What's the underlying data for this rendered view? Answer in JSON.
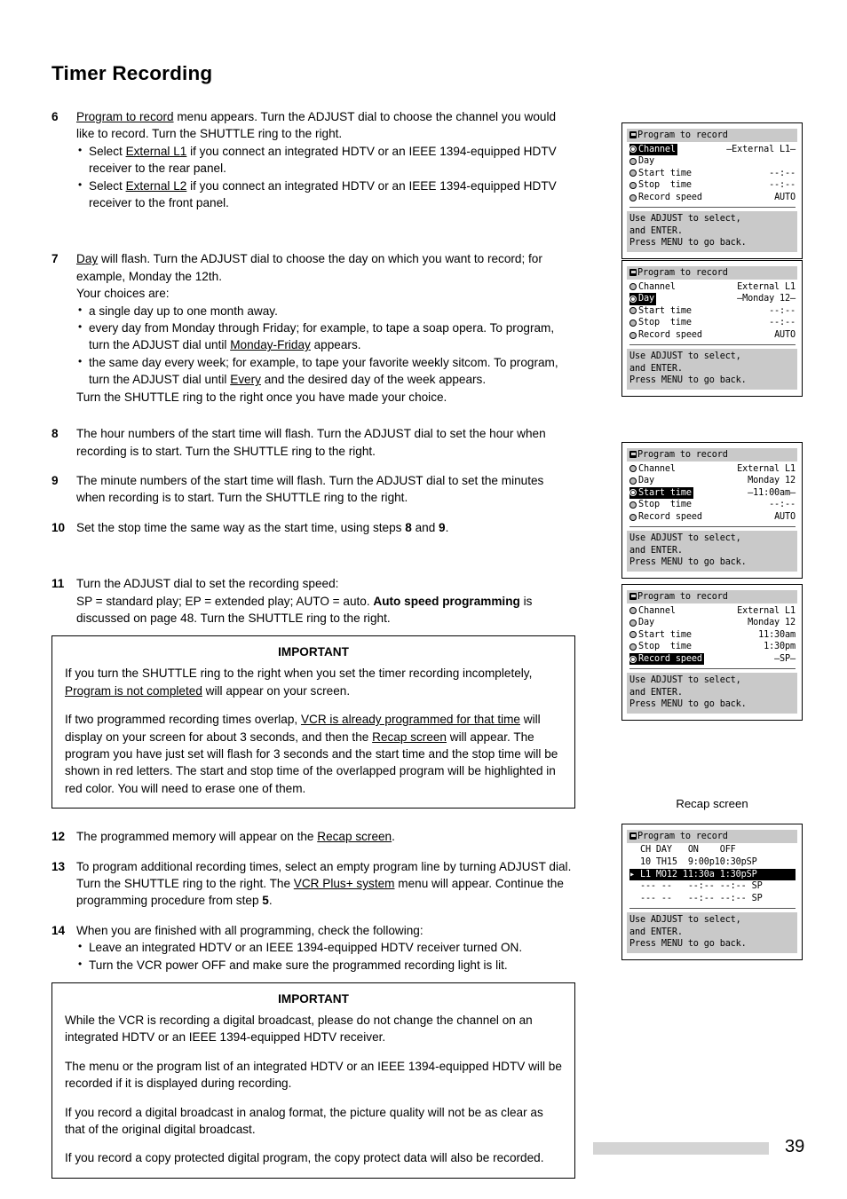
{
  "page": {
    "title": "Timer Recording",
    "number": "39"
  },
  "steps": [
    {
      "num": "6",
      "lines": [
        [
          {
            "t": "Program to record",
            "u": true
          },
          {
            "t": " menu appears.  Turn the ADJUST dial to choose the channel you would like to record.  Turn the SHUTTLE ring to the right."
          }
        ]
      ],
      "bullets": [
        [
          {
            "t": "Select "
          },
          {
            "t": "External L1",
            "u": true
          },
          {
            "t": " if you connect an integrated HDTV or an IEEE 1394-equipped HDTV receiver to the rear panel."
          }
        ],
        [
          {
            "t": "Select "
          },
          {
            "t": "External L2",
            "u": true
          },
          {
            "t": " if you connect an integrated HDTV or an IEEE 1394-equipped HDTV receiver to the front panel."
          }
        ]
      ]
    },
    {
      "num": "7",
      "lines": [
        [
          {
            "t": "Day",
            "u": true
          },
          {
            "t": " will flash.  Turn the ADJUST dial to choose the day on which you want to record; for example, Monday the 12th."
          }
        ],
        [
          {
            "t": "Your choices are:"
          }
        ]
      ],
      "bullets": [
        [
          {
            "t": "a single day up to one month away."
          }
        ],
        [
          {
            "t": "every day from Monday through Friday; for example, to tape a soap opera. To program, turn the ADJUST dial until "
          },
          {
            "t": "Monday-Friday",
            "u": true
          },
          {
            "t": " appears."
          }
        ],
        [
          {
            "t": "the same day every week; for example, to tape your favorite weekly sitcom. To program, turn the ADJUST dial until "
          },
          {
            "t": "Every",
            "u": true
          },
          {
            "t": " and the desired day of the week appears."
          }
        ]
      ],
      "after": [
        [
          {
            "t": "Turn the SHUTTLE ring to the right once you have made your choice."
          }
        ]
      ]
    },
    {
      "num": "8",
      "lines": [
        [
          {
            "t": "The hour numbers of the start time will flash.  Turn the ADJUST dial to set the hour when recording is to start.  Turn the SHUTTLE ring to the right."
          }
        ]
      ]
    },
    {
      "num": "9",
      "lines": [
        [
          {
            "t": "The minute numbers of the start time will flash.  Turn the ADJUST dial to set the minutes when recording is to start.  Turn the SHUTTLE ring to the right."
          }
        ]
      ]
    },
    {
      "num": "10",
      "lines": [
        [
          {
            "t": "Set the stop time the same way as the start time, using steps "
          },
          {
            "t": "8",
            "b": true
          },
          {
            "t": " and "
          },
          {
            "t": "9",
            "b": true
          },
          {
            "t": "."
          }
        ]
      ]
    },
    {
      "num": "11",
      "lines": [
        [
          {
            "t": "Turn the ADJUST dial to set the recording speed:"
          }
        ],
        [
          {
            "t": "SP = standard play; EP = extended play; AUTO = auto.  "
          },
          {
            "t": "Auto speed programming",
            "b": true
          },
          {
            "t": " is discussed on page 48.  Turn the SHUTTLE ring to the right."
          }
        ]
      ]
    },
    {
      "num": "12",
      "lines": [
        [
          {
            "t": "The programmed memory will appear on the "
          },
          {
            "t": "Recap screen",
            "u": true
          },
          {
            "t": "."
          }
        ]
      ]
    },
    {
      "num": "13",
      "lines": [
        [
          {
            "t": "To program additional recording times, select an empty program line by turning ADJUST dial.  Turn the SHUTTLE ring to the right.  The "
          },
          {
            "t": "VCR Plus+ system",
            "u": true
          },
          {
            "t": " menu will appear.  Continue the programming procedure from step "
          },
          {
            "t": "5",
            "b": true
          },
          {
            "t": "."
          }
        ]
      ]
    },
    {
      "num": "14",
      "lines": [
        [
          {
            "t": "When you are finished with all programming, check the following:"
          }
        ]
      ],
      "bullets": [
        [
          {
            "t": "Leave an integrated HDTV or an IEEE 1394-equipped HDTV receiver turned ON."
          }
        ],
        [
          {
            "t": "Turn the VCR power OFF and make sure the programmed recording light is lit."
          }
        ]
      ]
    }
  ],
  "important_box_1": {
    "title": "IMPORTANT",
    "paragraphs": [
      [
        {
          "t": "If you turn the SHUTTLE ring to the right when you set the timer recording incompletely, "
        },
        {
          "t": "Program is not completed",
          "u": true
        },
        {
          "t": " will appear on your screen."
        }
      ],
      [
        {
          "t": "If two programmed recording times overlap, "
        },
        {
          "t": "VCR is already programmed for that time",
          "u": true
        },
        {
          "t": " will display on your screen for about 3 seconds, and then the "
        },
        {
          "t": "Recap screen",
          "u": true
        },
        {
          "t": " will appear.  The program you have just set will flash for 3 seconds and the start time and the stop time will be shown in red letters.  The start and stop time of the overlapped program will be highlighted in red color.  You will need to erase one of them."
        }
      ]
    ]
  },
  "important_box_2": {
    "title": "IMPORTANT",
    "paragraphs": [
      [
        {
          "t": "While the VCR is recording a digital broadcast, please do not change the channel on an integrated HDTV or an IEEE 1394-equipped HDTV receiver."
        }
      ],
      [
        {
          "t": "The menu or the program list of an integrated HDTV or an IEEE 1394-equipped HDTV will be recorded if it is displayed during recording."
        }
      ],
      [
        {
          "t": "If you record a digital broadcast in analog format, the picture quality will not be as clear as that of the original digital broadcast."
        }
      ],
      [
        {
          "t": "If you record a copy protected digital program, the copy protect data will also be recorded."
        }
      ]
    ]
  },
  "osd_common": {
    "title": "Program to record",
    "help_lines": [
      "Use ADJUST to select,",
      "and ENTER.",
      "Press MENU to go back."
    ],
    "labels": {
      "channel": "Channel",
      "day": "Day",
      "start_time": "Start time",
      "stop_time": "Stop  time",
      "record_speed": "Record speed"
    }
  },
  "osd_screens": [
    {
      "id": "osd-channel",
      "highlight": "channel",
      "flash": "channel",
      "values": {
        "channel": "External L1",
        "day": "",
        "start_time": "--:--",
        "stop_time": "--:--",
        "record_speed": "AUTO"
      }
    },
    {
      "id": "osd-day",
      "highlight": "day",
      "flash": "day",
      "values": {
        "channel": "External L1",
        "day": "Monday 12",
        "start_time": "--:--",
        "stop_time": "--:--",
        "record_speed": "AUTO"
      }
    },
    {
      "id": "osd-start-time",
      "highlight": "start_time",
      "flash": "start_time",
      "values": {
        "channel": "External L1",
        "day": "Monday 12",
        "start_time": "11:00am",
        "stop_time": "--:--",
        "record_speed": "AUTO"
      }
    },
    {
      "id": "osd-record-speed",
      "highlight": "record_speed",
      "flash": "record_speed",
      "values": {
        "channel": "External L1",
        "day": "Monday 12",
        "start_time": "11:30am",
        "stop_time": "1:30pm",
        "record_speed": "SP"
      }
    }
  ],
  "recap": {
    "caption": "Recap screen",
    "title": "Program to record",
    "header": "  CH DAY   ON    OFF",
    "rows": [
      {
        "text": "  10 TH15  9:00p10:30pSP",
        "selected": false
      },
      {
        "text": "▸ L1 MO12 11:30a 1:30pSP",
        "selected": true
      },
      {
        "text": "  --- --   --:-- --:-- SP",
        "selected": false
      },
      {
        "text": "  --- --   --:-- --:-- SP",
        "selected": false
      }
    ],
    "help_lines": [
      "Use ADJUST to select,",
      "and ENTER.",
      "Press MENU to go back."
    ]
  }
}
